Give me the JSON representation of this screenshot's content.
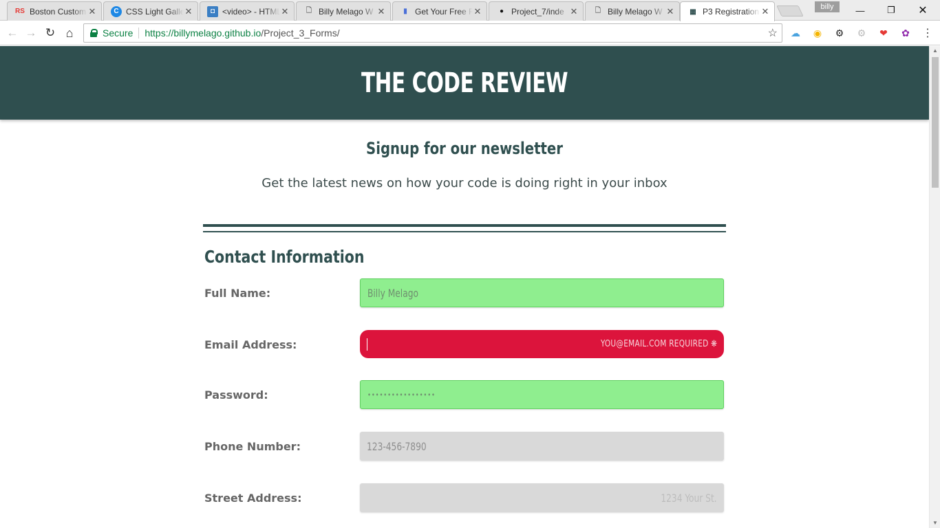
{
  "browser": {
    "tabs": [
      {
        "title": "Boston Custom",
        "favicon": "RS"
      },
      {
        "title": "CSS Light Galle",
        "favicon": "C"
      },
      {
        "title": "<video> - HTML",
        "favicon": "◘"
      },
      {
        "title": "Billy Melago W",
        "favicon": "🗋"
      },
      {
        "title": "Get Your Free F",
        "favicon": "▮"
      },
      {
        "title": "Project_7/inde",
        "favicon": "●"
      },
      {
        "title": "Billy Melago W",
        "favicon": "🗋"
      },
      {
        "title": "P3 Registration",
        "favicon": "▦"
      }
    ],
    "profile_name": "billy",
    "secure_label": "Secure",
    "url_host": "https://billymelago.github.io",
    "url_path": "/Project_3_Forms/"
  },
  "page": {
    "header_title": "THE CODE REVIEW",
    "heading": "Signup for our newsletter",
    "subheading": "Get the latest news on how your code is doing right in your inbox",
    "section_title": "Contact Information",
    "fields": {
      "full_name": {
        "label": "Full Name:",
        "value": "Billy Melago"
      },
      "email": {
        "label": "Email Address:",
        "value": "",
        "error": "YOU@EMAIL.COM REQUIRED ❋"
      },
      "password": {
        "label": "Password:",
        "value": "•••••••••••••••••"
      },
      "phone": {
        "label": "Phone Number:",
        "placeholder": "123-456-7890"
      },
      "street": {
        "label": "Street Address:",
        "placeholder": "1234 Your St."
      }
    }
  },
  "colors": {
    "header_bg": "#2f4f4f",
    "valid_bg": "#8fee8f",
    "invalid_bg": "#dc143c",
    "empty_bg": "#d9d9d9"
  }
}
